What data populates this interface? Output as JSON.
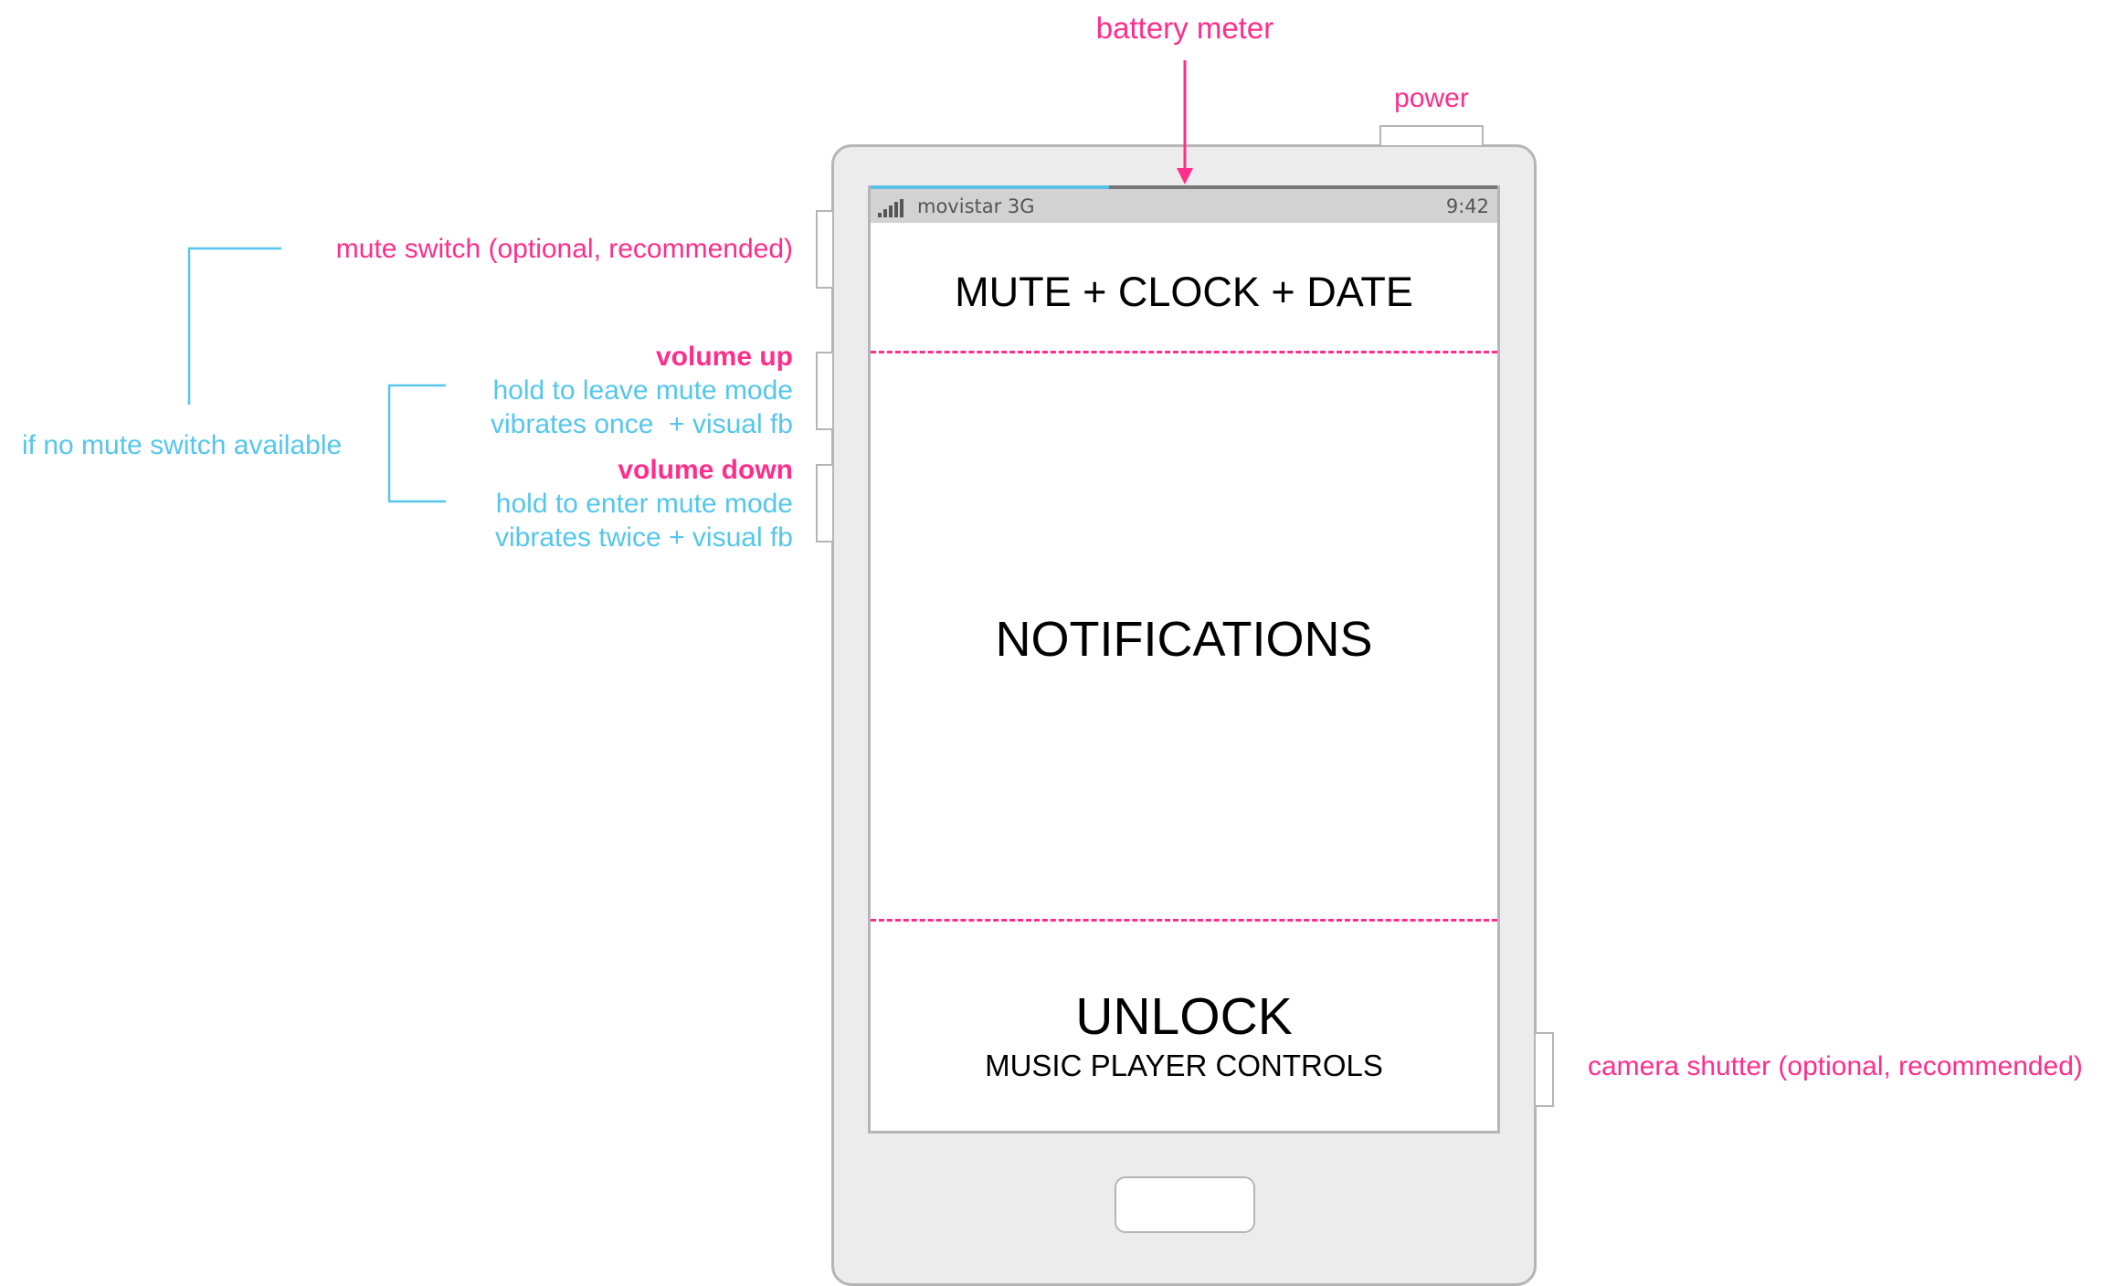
{
  "annotations": {
    "battery_meter": "battery meter",
    "power": "power",
    "mute_switch": "mute switch (optional, recommended)",
    "volume_up": "volume up",
    "volume_up_line1": "hold to leave mute mode",
    "volume_up_line2": "vibrates once  + visual fb",
    "volume_down": "volume down",
    "volume_down_line1": "hold to enter mute mode",
    "volume_down_line2": "vibrates twice + visual fb",
    "no_mute_switch": "if no mute switch available",
    "camera_shutter": "camera shutter (optional, recommended)"
  },
  "status_bar": {
    "carrier": "movistar 3G",
    "time": "9:42",
    "battery_level": 0.38,
    "signal_icon": "signal-bars-icon"
  },
  "screen": {
    "top_section": "MUTE + CLOCK + DATE",
    "middle_section": "NOTIFICATIONS",
    "bottom_title": "UNLOCK",
    "bottom_subtitle": "MUSIC PLAYER CONTROLS"
  },
  "colors": {
    "annotation_pink": "#ff2d8c",
    "annotation_cyan": "#55c6ec",
    "phone_body": "#ececec",
    "phone_outline": "#b5b5b5",
    "status_bar": "#d2d2d2",
    "battery_fill": "#5bc0e8"
  }
}
